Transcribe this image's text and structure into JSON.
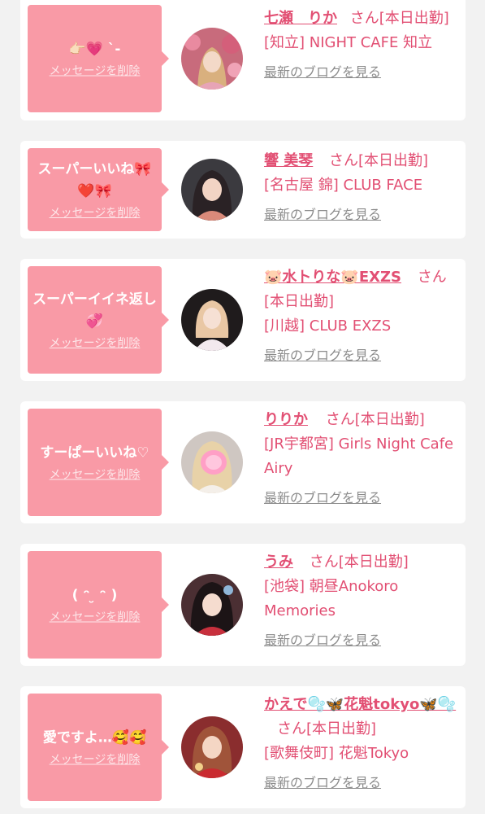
{
  "delete_label": "メッセージを削除",
  "blog_label": "最新のブログを見る",
  "cards": [
    {
      "message": "👉🏻💗 ˋ-",
      "name": "七瀬　りか",
      "honorific_status": "さん[本日出勤]",
      "shop": "[知立] NIGHT CAFE 知立"
    },
    {
      "message": "スーパーいいね🎀❤️🎀",
      "name": "響 美琴",
      "honorific_status": "さん[本日出勤]",
      "shop": "[名古屋 錦] CLUB FACE"
    },
    {
      "message": "スーパーイイネ返し💞",
      "name": "🐷水トりな🐷EXZS",
      "honorific_status": "さん[本日出勤]",
      "shop": "[川越] CLUB EXZS"
    },
    {
      "message": "すーぱーいいね♡",
      "name": "りりか",
      "honorific_status": "さん[本日出勤]",
      "shop": "[JR宇都宮] Girls Night Cafe Airy"
    },
    {
      "message": "( ᵔ ̮ ᵔ )",
      "name": "うみ",
      "honorific_status": "さん[本日出勤]",
      "shop": "[池袋] 朝昼Anokoro Memories"
    },
    {
      "message": "愛ですよ…🥰🥰",
      "name": "かえで🫧🦋花魁tokyo🦋🫧",
      "honorific_status": "さん[本日出勤]",
      "shop": "[歌舞伎町] 花魁Tokyo"
    }
  ],
  "colors": {
    "accent": "#e24f73",
    "bubble": "#f99aa6",
    "background": "#f2f2f2"
  }
}
